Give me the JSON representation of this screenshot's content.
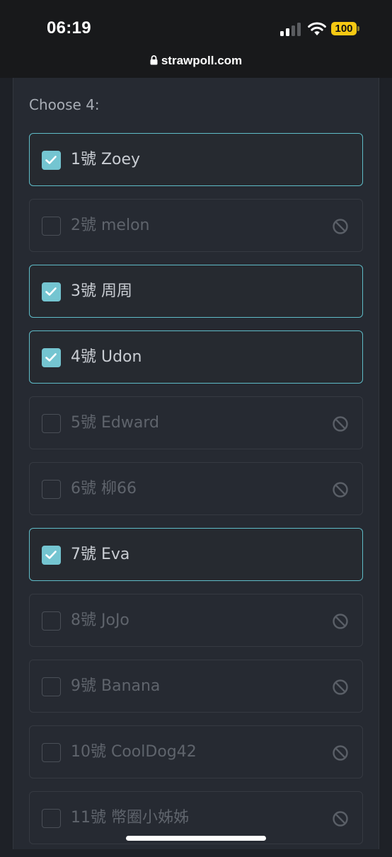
{
  "status_bar": {
    "time": "06:19",
    "battery": "100",
    "url": "strawpoll.com"
  },
  "poll": {
    "prompt": "Choose 4:",
    "options": [
      {
        "label": "1號 Zoey",
        "checked": true,
        "disabled": false
      },
      {
        "label": "2號 melon",
        "checked": false,
        "disabled": true
      },
      {
        "label": "3號 周周",
        "checked": true,
        "disabled": false
      },
      {
        "label": "4號 Udon",
        "checked": true,
        "disabled": false
      },
      {
        "label": "5號 Edward",
        "checked": false,
        "disabled": true
      },
      {
        "label": "6號 柳66",
        "checked": false,
        "disabled": true
      },
      {
        "label": "7號 Eva",
        "checked": true,
        "disabled": false
      },
      {
        "label": "8號 JoJo",
        "checked": false,
        "disabled": true
      },
      {
        "label": "9號 Banana",
        "checked": false,
        "disabled": true
      },
      {
        "label": "10號 CoolDog42",
        "checked": false,
        "disabled": true
      },
      {
        "label": "11號 幣圈小姊姊",
        "checked": false,
        "disabled": true
      }
    ]
  },
  "colors": {
    "accent": "#74c5d1",
    "checked_border": "#5fbcc8",
    "background": "#262a32"
  },
  "icons": {
    "checkbox_checked": "check-icon",
    "disabled_option": "no-entry-icon",
    "address_bar": "lock-icon"
  }
}
